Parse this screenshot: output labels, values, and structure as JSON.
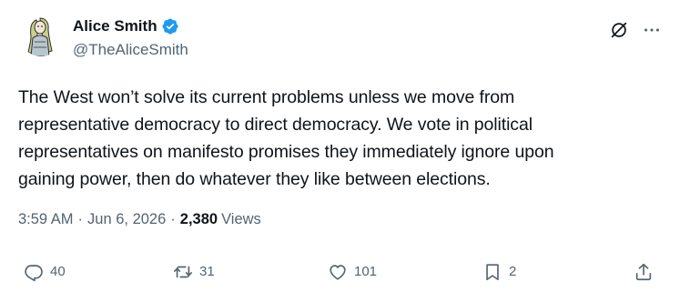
{
  "author": {
    "display_name": "Alice Smith",
    "handle": "@TheAliceSmith",
    "verified": true,
    "verified_color": "#1d9bf0"
  },
  "tweet": {
    "text": "The West won’t solve its current problems unless we move from\nrepresentative democracy to direct democracy. We vote in political\nrepresentatives on manifesto promises they immediately ignore upon\ngaining power, then do whatever they like between elections.",
    "time": "3:59 AM",
    "separator": "·",
    "date": "Jun 6, 2026",
    "views_count": "2,380",
    "views_label": "Views"
  },
  "actions": {
    "reply_count": "40",
    "repost_count": "31",
    "like_count": "101",
    "bookmark_count": "2"
  },
  "icons": {
    "reply": "reply-icon",
    "repost": "repost-icon",
    "like": "heart-icon",
    "bookmark": "bookmark-icon",
    "share": "share-icon",
    "grok": "grok-icon",
    "more": "more-icon",
    "verified": "verified-badge-icon"
  },
  "colors": {
    "text_primary": "#0f1419",
    "text_secondary": "#536471",
    "accent": "#1d9bf0"
  }
}
